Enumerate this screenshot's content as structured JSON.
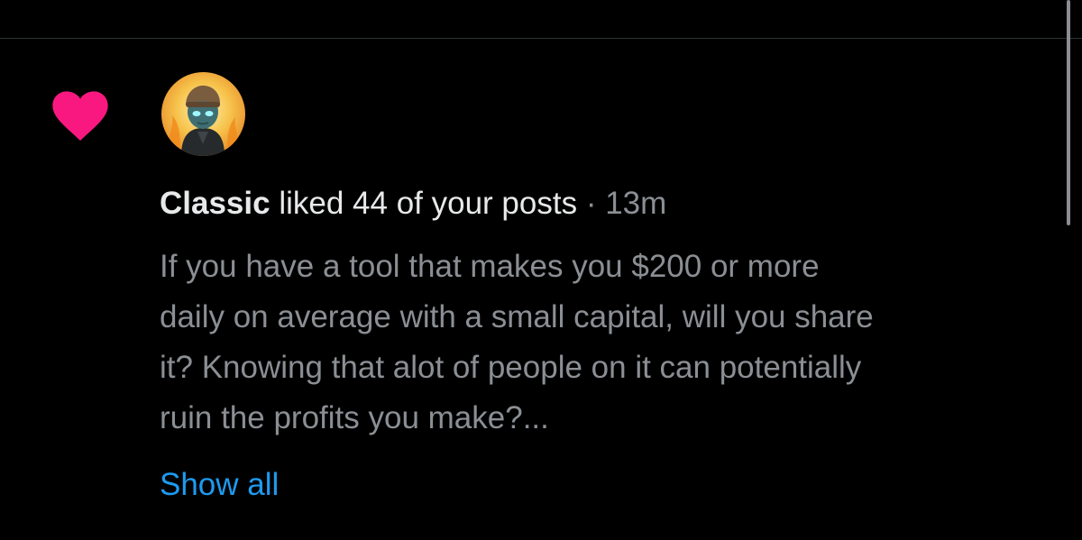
{
  "notification": {
    "type": "like",
    "user_name": "Classic",
    "action_text": "liked 44 of your posts",
    "separator": "·",
    "time": "13m",
    "post_lines": [
      "If you have a tool that makes you $200 or more",
      "daily on average with a small capital, will you share",
      "it? Knowing that alot of people on it can potentially",
      "ruin the profits you make?..."
    ],
    "show_all_label": "Show all"
  },
  "icons": {
    "like": "heart-icon",
    "avatar": "avatar"
  },
  "colors": {
    "background": "#000000",
    "heart": "#f91880",
    "primary_text": "#e7e9ea",
    "secondary_text": "#8b8f94",
    "link": "#1d9bf0",
    "divider": "#2f3336"
  }
}
